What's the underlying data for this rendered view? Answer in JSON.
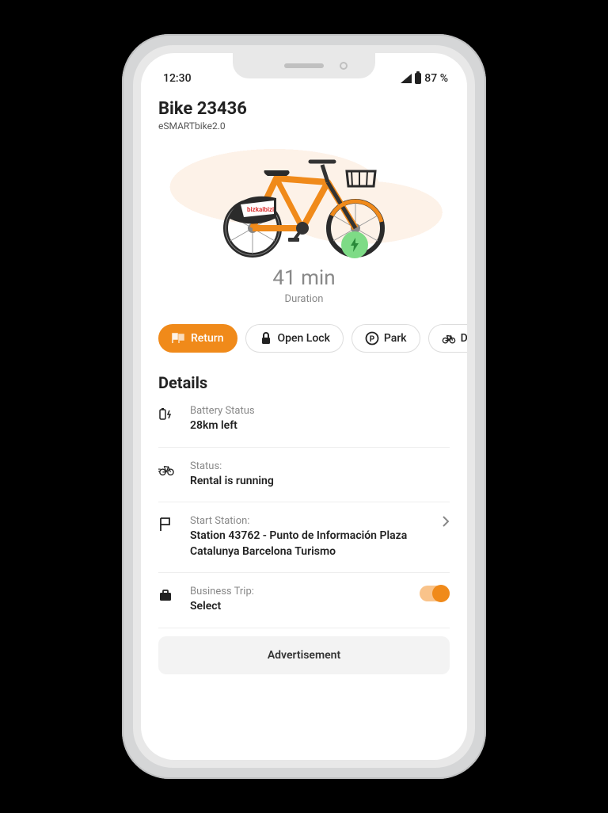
{
  "status_bar": {
    "time": "12:30",
    "battery_pct": "87 %"
  },
  "header": {
    "title": "Bike 23436",
    "subtitle": "eSMARTbike2.0",
    "brand_on_bike": "bizkaibizi"
  },
  "duration": {
    "value": "41 min",
    "label": "Duration"
  },
  "actions": {
    "return": "Return",
    "open_lock": "Open Lock",
    "park": "Park",
    "damage": "Da"
  },
  "details_title": "Details",
  "details": {
    "battery": {
      "label": "Battery Status",
      "value": "28km left"
    },
    "status": {
      "label": "Status:",
      "value": "Rental is running"
    },
    "start_station": {
      "label": "Start Station:",
      "value": "Station 43762 - Punto de Información Plaza Catalunya Barcelona Turismo"
    },
    "business_trip": {
      "label": "Business Trip:",
      "value": "Select"
    }
  },
  "ad_label": "Advertisement"
}
